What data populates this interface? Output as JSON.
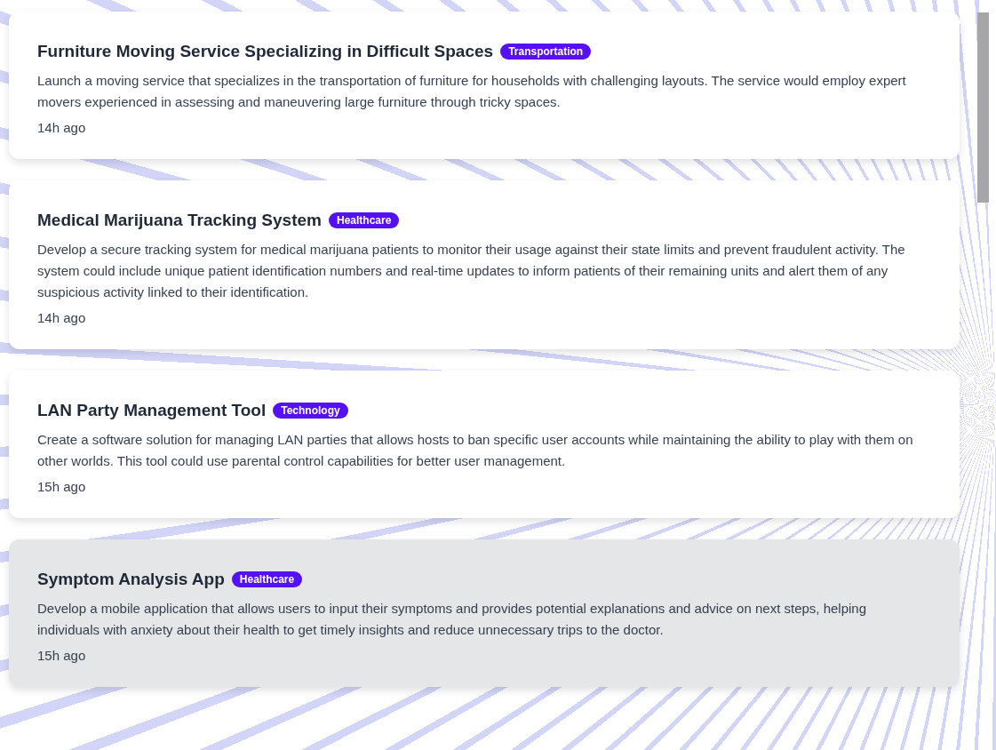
{
  "ideas": [
    {
      "title": "Furniture Moving Service Specializing in Difficult Spaces",
      "tag": "Transportation",
      "description": "Launch a moving service that specializes in the transportation of furniture for households with challenging layouts. The service would employ expert movers experienced in assessing and maneuvering large furniture through tricky spaces.",
      "time": "14h ago",
      "hovered": false
    },
    {
      "title": "Medical Marijuana Tracking System",
      "tag": "Healthcare",
      "description": "Develop a secure tracking system for medical marijuana patients to monitor their usage against their state limits and prevent fraudulent activity. The system could include unique patient identification numbers and real-time updates to inform patients of their remaining units and alert them of any suspicious activity linked to their identification.",
      "time": "14h ago",
      "hovered": false
    },
    {
      "title": "LAN Party Management Tool",
      "tag": "Technology",
      "description": "Create a software solution for managing LAN parties that allows hosts to ban specific user accounts while maintaining the ability to play with them on other worlds. This tool could use parental control capabilities for better user management.",
      "time": "15h ago",
      "hovered": false
    },
    {
      "title": "Symptom Analysis App",
      "tag": "Healthcare",
      "description": "Develop a mobile application that allows users to input their symptoms and provides potential explanations and advice on next steps, helping individuals with anxiety about their health to get timely insights and reduce unnecessary trips to the doctor.",
      "time": "15h ago",
      "hovered": true
    }
  ]
}
